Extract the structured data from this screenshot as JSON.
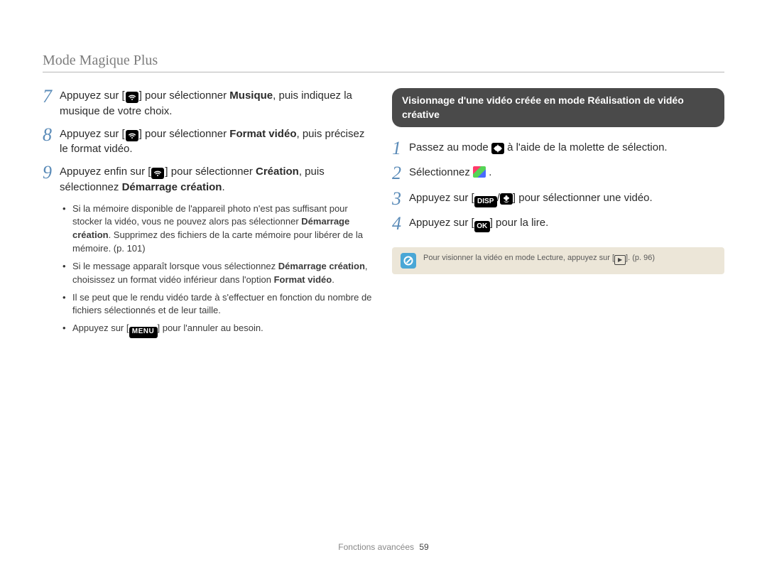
{
  "header": {
    "title": "Mode Magique Plus"
  },
  "left": {
    "steps": [
      {
        "num": "7",
        "text_before": "Appuyez sur [",
        "icon": "wifi",
        "text_mid": "] pour sélectionner ",
        "sel": "Musique",
        "text_after": ", puis indiquez la musique de votre choix."
      },
      {
        "num": "8",
        "text_before": "Appuyez sur [",
        "icon": "wifi",
        "text_mid": "] pour sélectionner ",
        "sel": "Format vidéo",
        "text_after": ", puis précisez le format vidéo."
      },
      {
        "num": "9",
        "text_before": "Appuyez enfin sur [",
        "icon": "wifi",
        "text_mid": "] pour sélectionner ",
        "sel": "Création",
        "text_after_before_sel2": ", puis sélectionnez ",
        "sel2": "Démarrage création",
        "text_after": "."
      }
    ],
    "bullets": [
      {
        "pre": "Si la mémoire disponible de l'appareil photo n'est pas suffisant pour stocker la vidéo, vous ne pouvez alors pas sélectionner ",
        "bold1": "Démarrage création",
        "mid": ". Supprimez des fichiers de la carte mémoire pour libérer de la mémoire. (p. 101)"
      },
      {
        "pre": "Si le message apparaît lorsque vous sélectionnez ",
        "bold1": "Démarrage création",
        "mid": ", choisissez un format vidéo inférieur dans l'option ",
        "bold2": "Format vidéo",
        "post": "."
      },
      {
        "pre": "Il se peut que le rendu vidéo tarde à s'effectuer en fonction du nombre de fichiers sélectionnés et de leur taille."
      },
      {
        "pre": "Appuyez sur [",
        "icon": "menu",
        "post": "] pour l'annuler au besoin."
      }
    ]
  },
  "right": {
    "heading": "Visionnage d'une vidéo créée en mode Réalisation de vidéo créative",
    "steps": [
      {
        "num": "1",
        "prefix": "Passez au mode ",
        "icon": "star",
        "suffix": " à l'aide de la molette de sélection."
      },
      {
        "num": "2",
        "prefix": "Sélectionnez ",
        "icon": "creative",
        "suffix": " ."
      },
      {
        "num": "3",
        "prefix": "Appuyez sur [",
        "icon1": "disp",
        "slash": "/",
        "icon2": "flower",
        "suffix": "] pour sélectionner une vidéo."
      },
      {
        "num": "4",
        "prefix": "Appuyez sur [",
        "icon": "ok",
        "suffix": "] pour la lire."
      }
    ],
    "note": {
      "text_before": "Pour visionner la vidéo en mode Lecture, appuyez sur [",
      "icon": "play",
      "text_after": "]. (p. 96)"
    }
  },
  "footer": {
    "label": "Fonctions avancées",
    "page": "59"
  }
}
